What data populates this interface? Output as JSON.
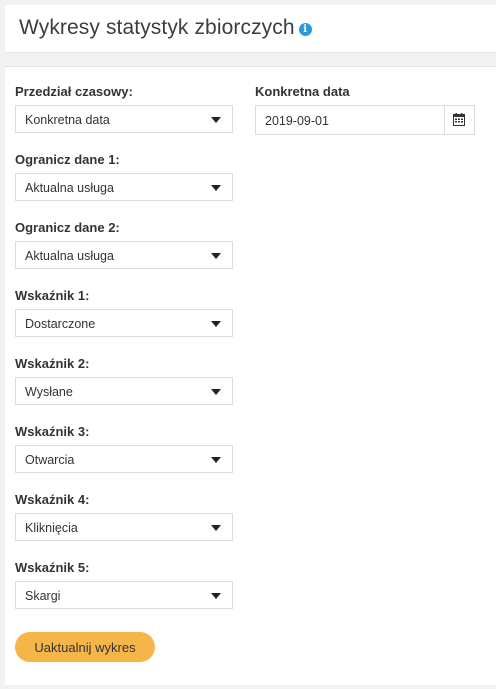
{
  "header": {
    "title": "Wykresy statystyk zbiorczych",
    "info_glyph": "i"
  },
  "form": {
    "time_range": {
      "label": "Przedział czasowy:",
      "value": "Konkretna data"
    },
    "specific_date": {
      "label": "Konkretna data",
      "value": "2019-09-01"
    },
    "filter1": {
      "label": "Ogranicz dane 1:",
      "value": "Aktualna usługa"
    },
    "filter2": {
      "label": "Ogranicz dane 2:",
      "value": "Aktualna usługa"
    },
    "indicator1": {
      "label": "Wskaźnik 1:",
      "value": "Dostarczone"
    },
    "indicator2": {
      "label": "Wskaźnik 2:",
      "value": "Wysłane"
    },
    "indicator3": {
      "label": "Wskaźnik 3:",
      "value": "Otwarcia"
    },
    "indicator4": {
      "label": "Wskaźnik 4:",
      "value": "Kliknięcia"
    },
    "indicator5": {
      "label": "Wskaźnik 5:",
      "value": "Skargi"
    },
    "update_button": "Uaktualnij wykres"
  },
  "colors": {
    "button": "#f5b548",
    "info_icon": "#2a9bd0"
  }
}
